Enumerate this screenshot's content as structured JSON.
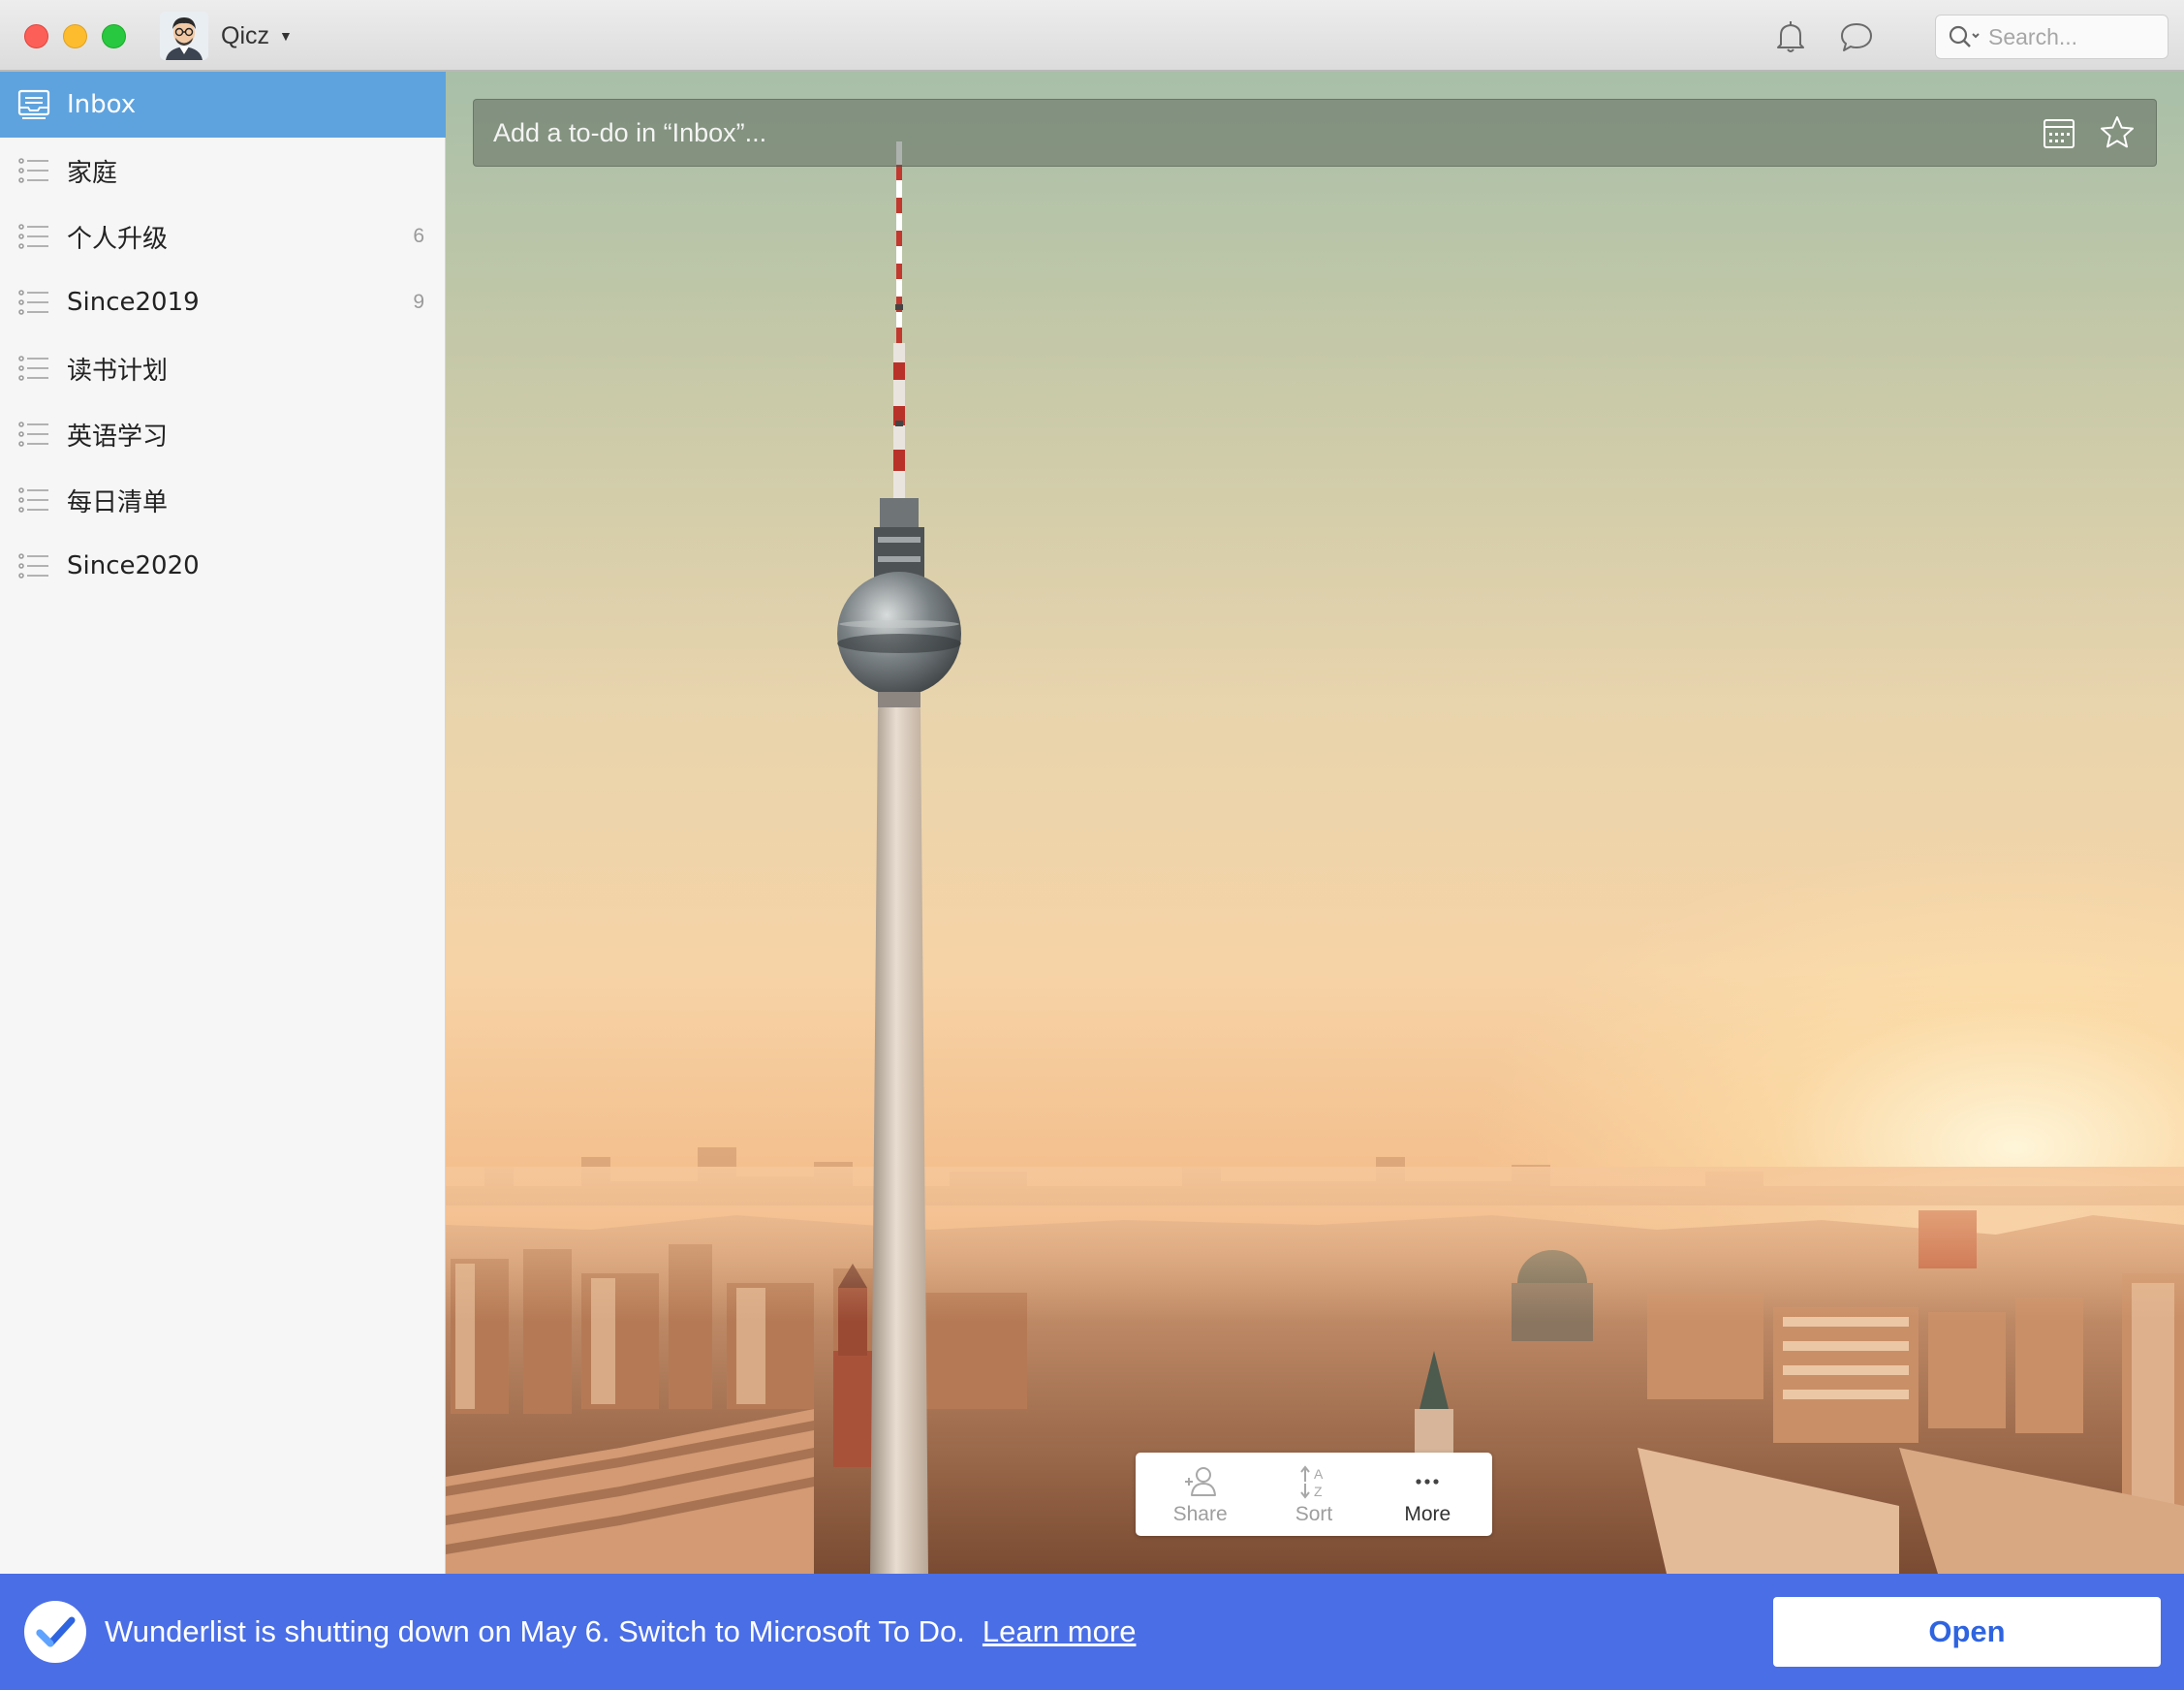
{
  "user": {
    "name": "Qicz"
  },
  "search": {
    "placeholder": "Search..."
  },
  "icons": {
    "traffic_close": "close-window-dot",
    "traffic_minimize": "minimize-window-dot",
    "traffic_zoom": "zoom-window-dot",
    "notifications": "bell-icon",
    "activity": "speech-bubble-icon",
    "search": "magnifier-icon",
    "inbox": "inbox-tray-icon",
    "list": "bullet-list-icon",
    "add_list": "plus-icon",
    "due_date": "calendar-icon",
    "star": "star-icon",
    "share": "add-person-icon",
    "sort": "sort-a-z-icon",
    "more": "ellipsis-icon",
    "microsoft_todo": "checkmark-logo-icon"
  },
  "colors": {
    "sidebar_active": "#5ea3de",
    "banner": "#4a6ee6",
    "open_button_text": "#2f64e0"
  },
  "sidebar": {
    "items": [
      {
        "label": "Inbox",
        "count": "",
        "active": true
      },
      {
        "label": "家庭",
        "count": ""
      },
      {
        "label": "个人升级",
        "count": "6"
      },
      {
        "label": "Since2019",
        "count": "9"
      },
      {
        "label": "读书计划",
        "count": ""
      },
      {
        "label": "英语学习",
        "count": ""
      },
      {
        "label": "每日清单",
        "count": ""
      },
      {
        "label": "Since2020",
        "count": ""
      }
    ]
  },
  "main": {
    "add_todo_placeholder": "Add a to-do in “Inbox”...",
    "toolbar": {
      "share": "Share",
      "sort": "Sort",
      "more": "More"
    }
  },
  "banner": {
    "message": "Wunderlist is shutting down on May 6. Switch to Microsoft To Do.",
    "link": "Learn more",
    "button": "Open"
  }
}
